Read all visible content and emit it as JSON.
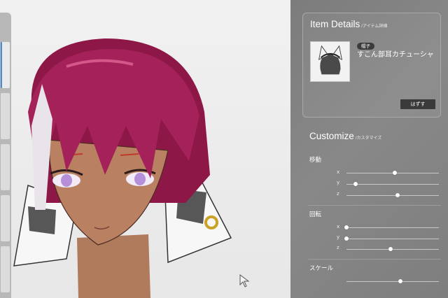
{
  "panel": {
    "item_details": {
      "title": "Item Details",
      "subtitle": "/アイテム詳細",
      "badge": "帽子",
      "item_name": "すこん部耳カチューシャ",
      "remove_label": "はずす"
    },
    "customize": {
      "title": "Customize",
      "subtitle": "/カスタマイズ",
      "groups": [
        {
          "label": "移動",
          "axes": [
            {
              "axis": "x",
              "value": 0.52
            },
            {
              "axis": "y",
              "value": 0.1
            },
            {
              "axis": "z",
              "value": 0.55
            }
          ]
        },
        {
          "label": "回転",
          "axes": [
            {
              "axis": "x",
              "value": 0.0
            },
            {
              "axis": "y",
              "value": 0.0
            },
            {
              "axis": "z",
              "value": 0.48
            }
          ]
        },
        {
          "label": "スケール",
          "axes": [
            {
              "axis": "",
              "value": 0.58
            }
          ]
        }
      ]
    }
  },
  "icons": [
    "character-preview",
    "headband-thumbnail-icon",
    "mouse-cursor-icon"
  ],
  "colors": {
    "panel_bg": "#808080",
    "hair": "#9e1f52",
    "button": "#3a3a3a"
  }
}
